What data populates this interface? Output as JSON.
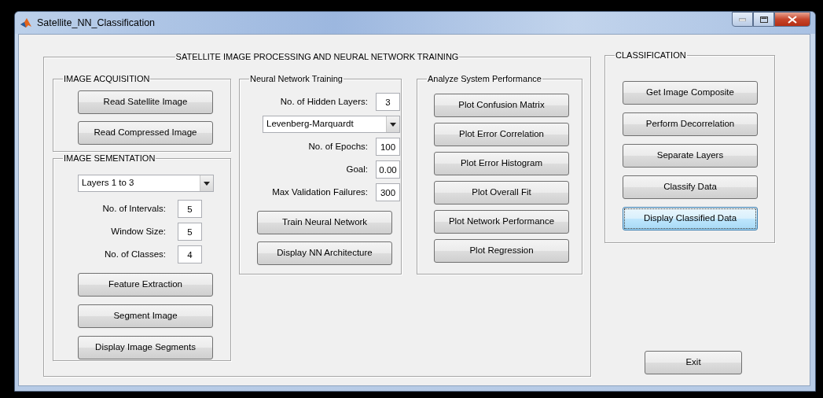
{
  "window": {
    "title": "Satellite_NN_Classification"
  },
  "main_panel": {
    "title": "SATELLITE IMAGE PROCESSING AND NEURAL NETWORK TRAINING",
    "image_acquisition": {
      "title": "IMAGE ACQUISITION",
      "controls": [
        {
          "kind": "button",
          "label": "Read Satellite Image"
        },
        {
          "kind": "button",
          "label": "Read Compressed Image"
        }
      ]
    },
    "image_segmentation": {
      "title": "IMAGE SEMENTATION",
      "controls": [
        {
          "kind": "dropdown",
          "value": "Layers 1 to 3"
        },
        {
          "kind": "field",
          "label": "No. of Intervals:",
          "value": "5"
        },
        {
          "kind": "field",
          "label": "Window Size:",
          "value": "5"
        },
        {
          "kind": "field",
          "label": "No. of Classes:",
          "value": "4"
        },
        {
          "kind": "button",
          "label": "Feature Extraction"
        },
        {
          "kind": "button",
          "label": "Segment Image"
        },
        {
          "kind": "button",
          "label": "Display Image Segments"
        }
      ]
    },
    "nn_training": {
      "title": "Neural Network Training",
      "controls": [
        {
          "kind": "field",
          "label": "No. of Hidden Layers:",
          "value": "3"
        },
        {
          "kind": "dropdown",
          "value": "Levenberg-Marquardt"
        },
        {
          "kind": "field",
          "label": "No. of Epochs:",
          "value": "100"
        },
        {
          "kind": "field",
          "label": "Goal:",
          "value": "0.00"
        },
        {
          "kind": "field",
          "label": "Max Validation Failures:",
          "value": "300"
        },
        {
          "kind": "button",
          "label": "Train Neural Network"
        },
        {
          "kind": "button",
          "label": "Display NN Architecture"
        }
      ]
    },
    "performance": {
      "title": "Analyze System Performance",
      "controls": [
        {
          "kind": "button",
          "label": "Plot Confusion Matrix"
        },
        {
          "kind": "button",
          "label": "Plot Error Correlation"
        },
        {
          "kind": "button",
          "label": "Plot Error Histogram"
        },
        {
          "kind": "button",
          "label": "Plot Overall Fit"
        },
        {
          "kind": "button",
          "label": "Plot Network Performance"
        },
        {
          "kind": "button",
          "label": "Plot Regression"
        }
      ]
    }
  },
  "classification": {
    "title": "CLASSIFICATION",
    "buttons": [
      {
        "label": "Get Image Composite",
        "focused": false
      },
      {
        "label": "Perform Decorrelation",
        "focused": false
      },
      {
        "label": "Separate Layers",
        "focused": false
      },
      {
        "label": "Classify Data",
        "focused": false
      },
      {
        "label": "Display Classified Data",
        "focused": true
      }
    ]
  },
  "exit_button": {
    "label": "Exit"
  }
}
